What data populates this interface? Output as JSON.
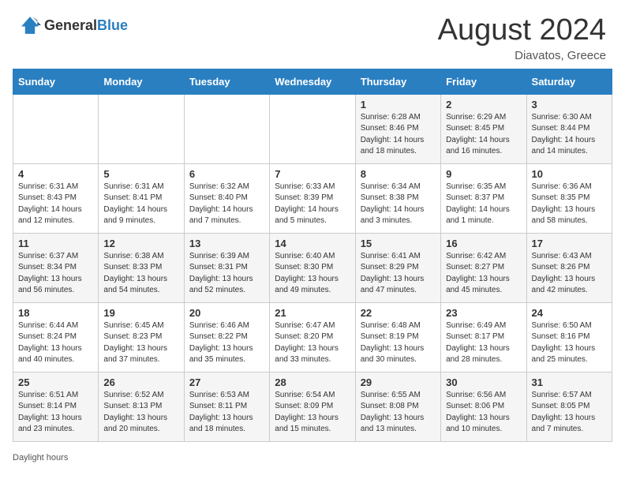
{
  "header": {
    "logo_general": "General",
    "logo_blue": "Blue",
    "month_year": "August 2024",
    "location": "Diavatos, Greece"
  },
  "days_of_week": [
    "Sunday",
    "Monday",
    "Tuesday",
    "Wednesday",
    "Thursday",
    "Friday",
    "Saturday"
  ],
  "weeks": [
    [
      {
        "day": "",
        "info": ""
      },
      {
        "day": "",
        "info": ""
      },
      {
        "day": "",
        "info": ""
      },
      {
        "day": "",
        "info": ""
      },
      {
        "day": "1",
        "info": "Sunrise: 6:28 AM\nSunset: 8:46 PM\nDaylight: 14 hours\nand 18 minutes."
      },
      {
        "day": "2",
        "info": "Sunrise: 6:29 AM\nSunset: 8:45 PM\nDaylight: 14 hours\nand 16 minutes."
      },
      {
        "day": "3",
        "info": "Sunrise: 6:30 AM\nSunset: 8:44 PM\nDaylight: 14 hours\nand 14 minutes."
      }
    ],
    [
      {
        "day": "4",
        "info": "Sunrise: 6:31 AM\nSunset: 8:43 PM\nDaylight: 14 hours\nand 12 minutes."
      },
      {
        "day": "5",
        "info": "Sunrise: 6:31 AM\nSunset: 8:41 PM\nDaylight: 14 hours\nand 9 minutes."
      },
      {
        "day": "6",
        "info": "Sunrise: 6:32 AM\nSunset: 8:40 PM\nDaylight: 14 hours\nand 7 minutes."
      },
      {
        "day": "7",
        "info": "Sunrise: 6:33 AM\nSunset: 8:39 PM\nDaylight: 14 hours\nand 5 minutes."
      },
      {
        "day": "8",
        "info": "Sunrise: 6:34 AM\nSunset: 8:38 PM\nDaylight: 14 hours\nand 3 minutes."
      },
      {
        "day": "9",
        "info": "Sunrise: 6:35 AM\nSunset: 8:37 PM\nDaylight: 14 hours\nand 1 minute."
      },
      {
        "day": "10",
        "info": "Sunrise: 6:36 AM\nSunset: 8:35 PM\nDaylight: 13 hours\nand 58 minutes."
      }
    ],
    [
      {
        "day": "11",
        "info": "Sunrise: 6:37 AM\nSunset: 8:34 PM\nDaylight: 13 hours\nand 56 minutes."
      },
      {
        "day": "12",
        "info": "Sunrise: 6:38 AM\nSunset: 8:33 PM\nDaylight: 13 hours\nand 54 minutes."
      },
      {
        "day": "13",
        "info": "Sunrise: 6:39 AM\nSunset: 8:31 PM\nDaylight: 13 hours\nand 52 minutes."
      },
      {
        "day": "14",
        "info": "Sunrise: 6:40 AM\nSunset: 8:30 PM\nDaylight: 13 hours\nand 49 minutes."
      },
      {
        "day": "15",
        "info": "Sunrise: 6:41 AM\nSunset: 8:29 PM\nDaylight: 13 hours\nand 47 minutes."
      },
      {
        "day": "16",
        "info": "Sunrise: 6:42 AM\nSunset: 8:27 PM\nDaylight: 13 hours\nand 45 minutes."
      },
      {
        "day": "17",
        "info": "Sunrise: 6:43 AM\nSunset: 8:26 PM\nDaylight: 13 hours\nand 42 minutes."
      }
    ],
    [
      {
        "day": "18",
        "info": "Sunrise: 6:44 AM\nSunset: 8:24 PM\nDaylight: 13 hours\nand 40 minutes."
      },
      {
        "day": "19",
        "info": "Sunrise: 6:45 AM\nSunset: 8:23 PM\nDaylight: 13 hours\nand 37 minutes."
      },
      {
        "day": "20",
        "info": "Sunrise: 6:46 AM\nSunset: 8:22 PM\nDaylight: 13 hours\nand 35 minutes."
      },
      {
        "day": "21",
        "info": "Sunrise: 6:47 AM\nSunset: 8:20 PM\nDaylight: 13 hours\nand 33 minutes."
      },
      {
        "day": "22",
        "info": "Sunrise: 6:48 AM\nSunset: 8:19 PM\nDaylight: 13 hours\nand 30 minutes."
      },
      {
        "day": "23",
        "info": "Sunrise: 6:49 AM\nSunset: 8:17 PM\nDaylight: 13 hours\nand 28 minutes."
      },
      {
        "day": "24",
        "info": "Sunrise: 6:50 AM\nSunset: 8:16 PM\nDaylight: 13 hours\nand 25 minutes."
      }
    ],
    [
      {
        "day": "25",
        "info": "Sunrise: 6:51 AM\nSunset: 8:14 PM\nDaylight: 13 hours\nand 23 minutes."
      },
      {
        "day": "26",
        "info": "Sunrise: 6:52 AM\nSunset: 8:13 PM\nDaylight: 13 hours\nand 20 minutes."
      },
      {
        "day": "27",
        "info": "Sunrise: 6:53 AM\nSunset: 8:11 PM\nDaylight: 13 hours\nand 18 minutes."
      },
      {
        "day": "28",
        "info": "Sunrise: 6:54 AM\nSunset: 8:09 PM\nDaylight: 13 hours\nand 15 minutes."
      },
      {
        "day": "29",
        "info": "Sunrise: 6:55 AM\nSunset: 8:08 PM\nDaylight: 13 hours\nand 13 minutes."
      },
      {
        "day": "30",
        "info": "Sunrise: 6:56 AM\nSunset: 8:06 PM\nDaylight: 13 hours\nand 10 minutes."
      },
      {
        "day": "31",
        "info": "Sunrise: 6:57 AM\nSunset: 8:05 PM\nDaylight: 13 hours\nand 7 minutes."
      }
    ]
  ],
  "footer": {
    "daylight_label": "Daylight hours"
  }
}
